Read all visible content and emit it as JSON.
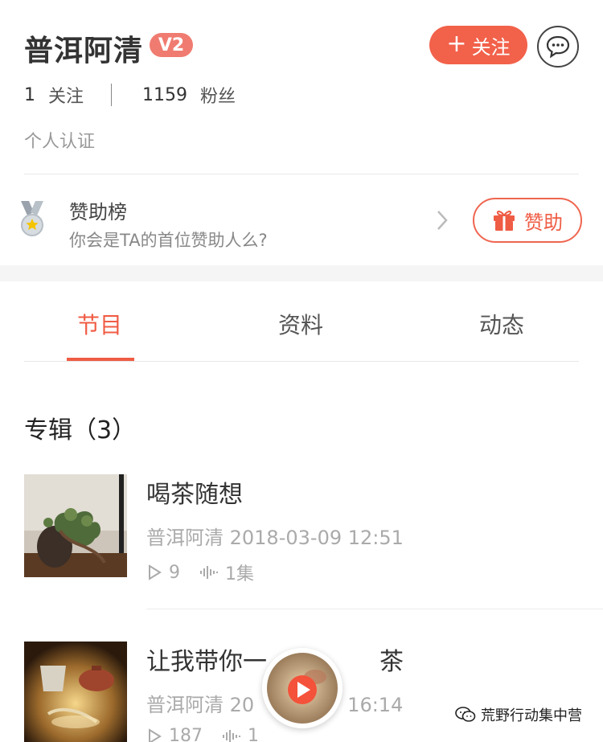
{
  "profile": {
    "name": "普洱阿清",
    "badge": "V2",
    "follow_label": "关注",
    "follow_plus": "+",
    "following_count": "1",
    "following_label": "关注",
    "fans_count": "1159",
    "fans_label": "粉丝",
    "certification": "个人认证"
  },
  "sponsor": {
    "title": "赞助榜",
    "subtitle": "你会是TA的首位赞助人么?",
    "button_label": "赞助"
  },
  "tabs": [
    {
      "label": "节目",
      "active": true
    },
    {
      "label": "资料",
      "active": false
    },
    {
      "label": "动态",
      "active": false
    }
  ],
  "section": {
    "title": "专辑（3）"
  },
  "albums": [
    {
      "title": "喝茶随想",
      "meta": "普洱阿清 2018-03-09 12:51",
      "plays": "9",
      "episodes": "1集"
    },
    {
      "title": "让我带你一",
      "title_tail": "茶",
      "meta": "普洱阿清 20",
      "meta_tail": "16:14",
      "plays": "187",
      "episodes": "1"
    }
  ],
  "watermark": "荒野行动集中营",
  "colors": {
    "accent": "#f2614a",
    "badge": "#f07b70"
  },
  "icons": {
    "message": "chat-bubble-icon",
    "medal": "medal-icon",
    "gift": "gift-icon",
    "play": "play-icon",
    "audio": "audio-wave-icon",
    "chevron": "chevron-right-icon"
  }
}
